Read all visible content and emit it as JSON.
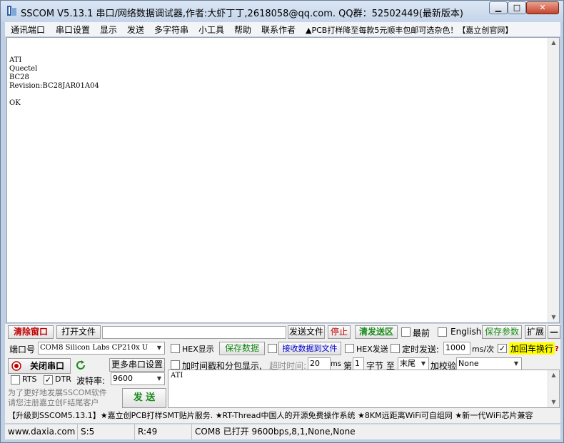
{
  "window": {
    "title": "SSCOM V5.13.1 串口/网络数据调试器,作者:大虾丁丁,2618058@qq.com. QQ群：52502449(最新版本)"
  },
  "menu": [
    "通讯端口",
    "串口设置",
    "显示",
    "发送",
    "多字符串",
    "小工具",
    "帮助",
    "联系作者",
    "▲PCB打样降至每款5元顺丰包邮可选杂色！【嘉立创官网】"
  ],
  "receive": {
    "text": "ATI\nQuectel\nBC28\nRevision:BC28JAR01A04\n\nOK"
  },
  "row1": {
    "clear": "清除窗口",
    "open_file": "打开文件",
    "file_path": "",
    "send_file": "发送文件",
    "stop": "停止",
    "clear_send": "清发送区",
    "latest_label": "最前",
    "english_label": "English",
    "save_params": "保存参数",
    "expand": "扩展",
    "collapse": "—"
  },
  "row2": {
    "port_label": "端口号",
    "port_value": "COM8 Silicon Labs CP210x U",
    "hex_display_label": "HEX显示",
    "save_data": "保存数据",
    "recv_to_file_label": "接收数据到文件",
    "hex_send_label": "HEX发送",
    "timed_send_label": "定时发送:",
    "interval_value": "1000",
    "interval_unit": "ms/次",
    "crlf_label": "加回车换行"
  },
  "row3": {
    "close_port": "关闭串口",
    "more_settings": "更多串口设置",
    "timestamp_label": "加时间戳和分包显示,",
    "timeout_label": "超时时间:",
    "timeout_value": "20",
    "timeout_unit": "ms",
    "nth_label": "第",
    "nth_value": "1",
    "byte_label": "字节",
    "to_label": "至",
    "end_value": "末尾",
    "checksum_label": "加校验",
    "checksum_value": "None"
  },
  "row4": {
    "rts_label": "RTS",
    "dtr_label": "DTR",
    "baud_label": "波特率:",
    "baud_value": "9600"
  },
  "promo": {
    "line1": "为了更好地发展SSCOM软件",
    "line2": "请您注册嘉立创F结尾客户"
  },
  "send": {
    "button": "发 送",
    "text": "ATI"
  },
  "ticker": "【升级到SSCOM5.13.1】★嘉立创PCB打样SMT贴片服务. ★RT-Thread中国人的开源免费操作系统 ★8KM远距离WiFi可自组网 ★新一代WiFi芯片兼容",
  "status": {
    "site": "www.daxia.com",
    "sent": "S:5",
    "received": "R:49",
    "port_state": "COM8 已打开  9600bps,8,1,None,None"
  },
  "colors": {
    "accent_blue": "#0000cc",
    "green_text": "#1a8a1a",
    "red_text": "#c00000",
    "crlf_highlight": "#ffff00"
  }
}
